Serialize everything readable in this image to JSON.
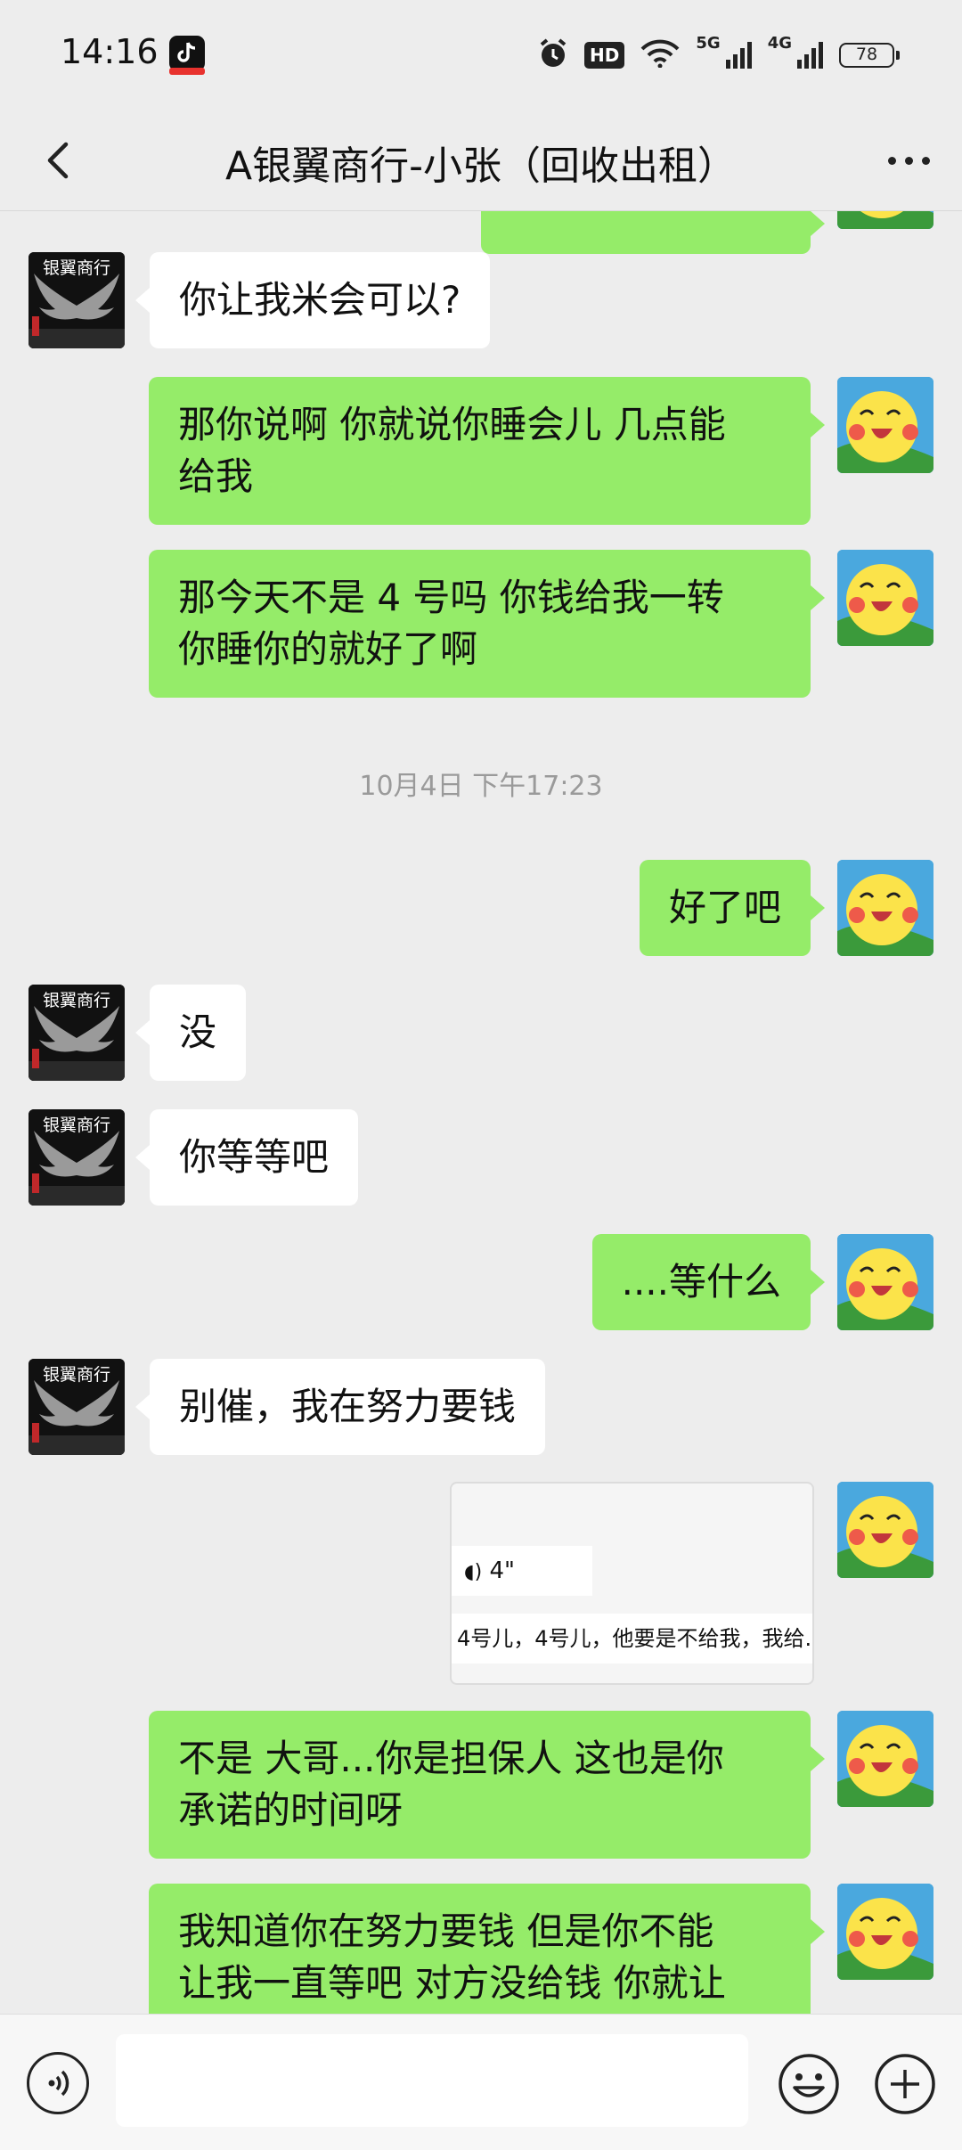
{
  "status_bar": {
    "time": "14:16",
    "hd_label": "HD",
    "net_5g": "5G",
    "net_4g": "4G",
    "battery": "78"
  },
  "header": {
    "title": "A银翼商行-小张（回收出租）"
  },
  "messages": [
    {
      "side": "other",
      "text": "你让我米会可以?"
    },
    {
      "side": "self",
      "lines": [
        "那你说啊 你就说你睡会儿 几点能",
        "给我"
      ]
    },
    {
      "side": "self",
      "lines": [
        "那今天不是 4 号吗 你钱给我一转",
        "你睡你的就好了啊"
      ]
    },
    {
      "side": "self",
      "text": "好了吧"
    },
    {
      "side": "other",
      "text": "没"
    },
    {
      "side": "other",
      "text": "你等等吧"
    },
    {
      "side": "self",
      "text": "....等什么"
    },
    {
      "side": "other",
      "text": "别催，我在努力要钱"
    },
    {
      "side": "self",
      "lines": [
        "不是 大哥...你是担保人  这也是你",
        "承诺的时间呀"
      ]
    },
    {
      "side": "self",
      "lines": [
        "我知道你在努力要钱  但是你不能",
        "让我一直等吧  对方没给钱  你就让"
      ]
    }
  ],
  "timestamp": "10月4日 下午17:23",
  "quote": {
    "voice_duration": "4\"",
    "text": "4号儿，4号儿，他要是不给我，我给..."
  },
  "avatar_other_text": "银翼商行",
  "icons": {
    "back": "chevron-left-icon",
    "more": "more-dots-icon",
    "voice": "voice-icon",
    "emoji": "emoji-icon",
    "plus": "plus-icon"
  },
  "colors": {
    "self_bubble": "#95ec69",
    "other_bubble": "#ffffff",
    "background": "#ededed"
  }
}
